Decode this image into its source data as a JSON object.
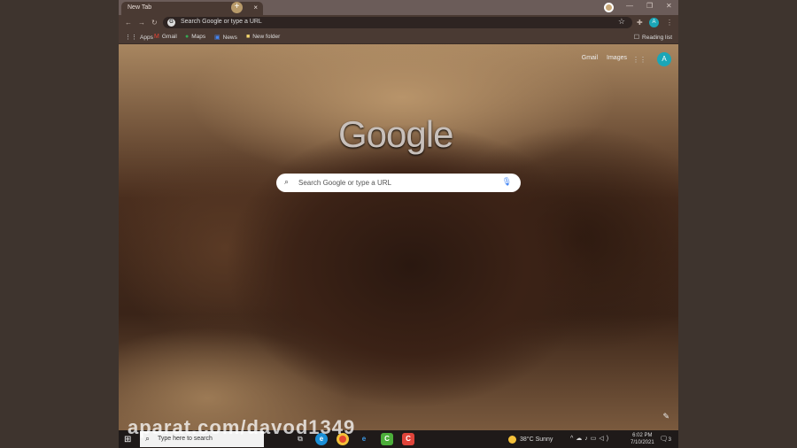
{
  "browser": {
    "tab_title": "New Tab",
    "omnibox_placeholder": "Search Google or type a URL",
    "profile_initial": "A",
    "bookmarks": [
      {
        "icon": "apps-icon",
        "label": "Apps"
      },
      {
        "icon": "gmail-icon",
        "label": "Gmail"
      },
      {
        "icon": "maps-icon",
        "label": "Maps"
      },
      {
        "icon": "news-icon",
        "label": "News"
      },
      {
        "icon": "folder-icon",
        "label": "New folder"
      }
    ],
    "reading_list": "Reading list"
  },
  "ntp": {
    "links": [
      "Gmail",
      "Images"
    ],
    "logo": "Google",
    "search_placeholder": "Search Google or type a URL",
    "avatar": "A"
  },
  "watermark": "aparat.com/davod1349",
  "taskbar": {
    "search_placeholder": "Type here to search",
    "weather": "38°C  Sunny",
    "time": "6:02 PM",
    "date": "7/10/2021",
    "notifications": "3"
  }
}
